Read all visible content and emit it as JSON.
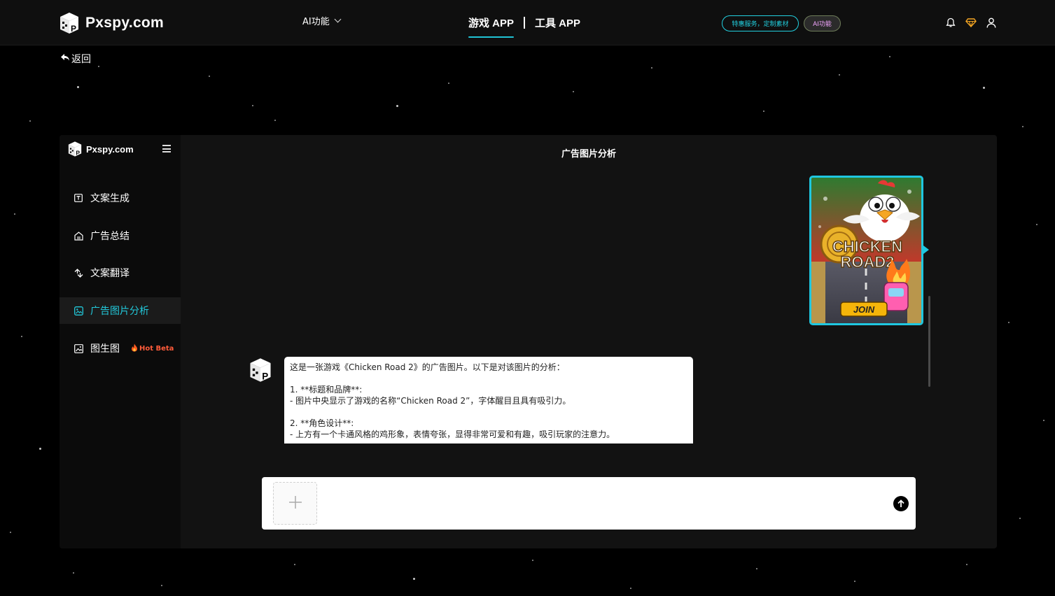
{
  "header": {
    "brand": "Pxspy.com",
    "ai_menu_label": "AI功能",
    "nav_tabs": [
      {
        "label": "游戏 APP",
        "active": true
      },
      {
        "label": "工具 APP",
        "active": false
      }
    ],
    "service_pill": "特惠服务，定制素材",
    "ai_pill": "AI功能",
    "icons": [
      "bell-icon",
      "diamond-icon",
      "user-icon"
    ]
  },
  "back_label": "返回",
  "sidebar": {
    "brand": "Pxspy.com",
    "items": [
      {
        "label": "文案生成",
        "icon": "text-box-icon",
        "active": false
      },
      {
        "label": "广告总结",
        "icon": "home-doc-icon",
        "active": false
      },
      {
        "label": "文案翻译",
        "icon": "translate-icon",
        "active": false
      },
      {
        "label": "广告图片分析",
        "icon": "image-analyze-icon",
        "active": true
      },
      {
        "label": "图生图",
        "icon": "image-icon",
        "active": false,
        "badge": "Hot Beta"
      }
    ]
  },
  "chat": {
    "title": "广告图片分析",
    "user_image_text": {
      "title_line1": "CHICKEN",
      "title_line2": "ROAD2",
      "cta": "JOIN"
    },
    "bot_message": [
      "这是一张游戏《Chicken Road 2》的广告图片。以下是对该图片的分析：",
      "",
      "1. **标题和品牌**:",
      "- 图片中央显示了游戏的名称“Chicken Road 2”，字体醒目且具有吸引力。",
      "",
      "2. **角色设计**:",
      "- 上方有一个卡通风格的鸡形象，表情夸张，显得非常可爱和有趣，吸引玩家的注意力。"
    ]
  },
  "input": {
    "placeholder": "",
    "upload_icon": "plus-icon",
    "send_icon": "arrow-up-icon"
  },
  "colors": {
    "accent": "#22c8da",
    "background": "#000000",
    "panel": "#121212",
    "sidebar": "#0b0b0b",
    "hot": "#ff5b3a"
  }
}
